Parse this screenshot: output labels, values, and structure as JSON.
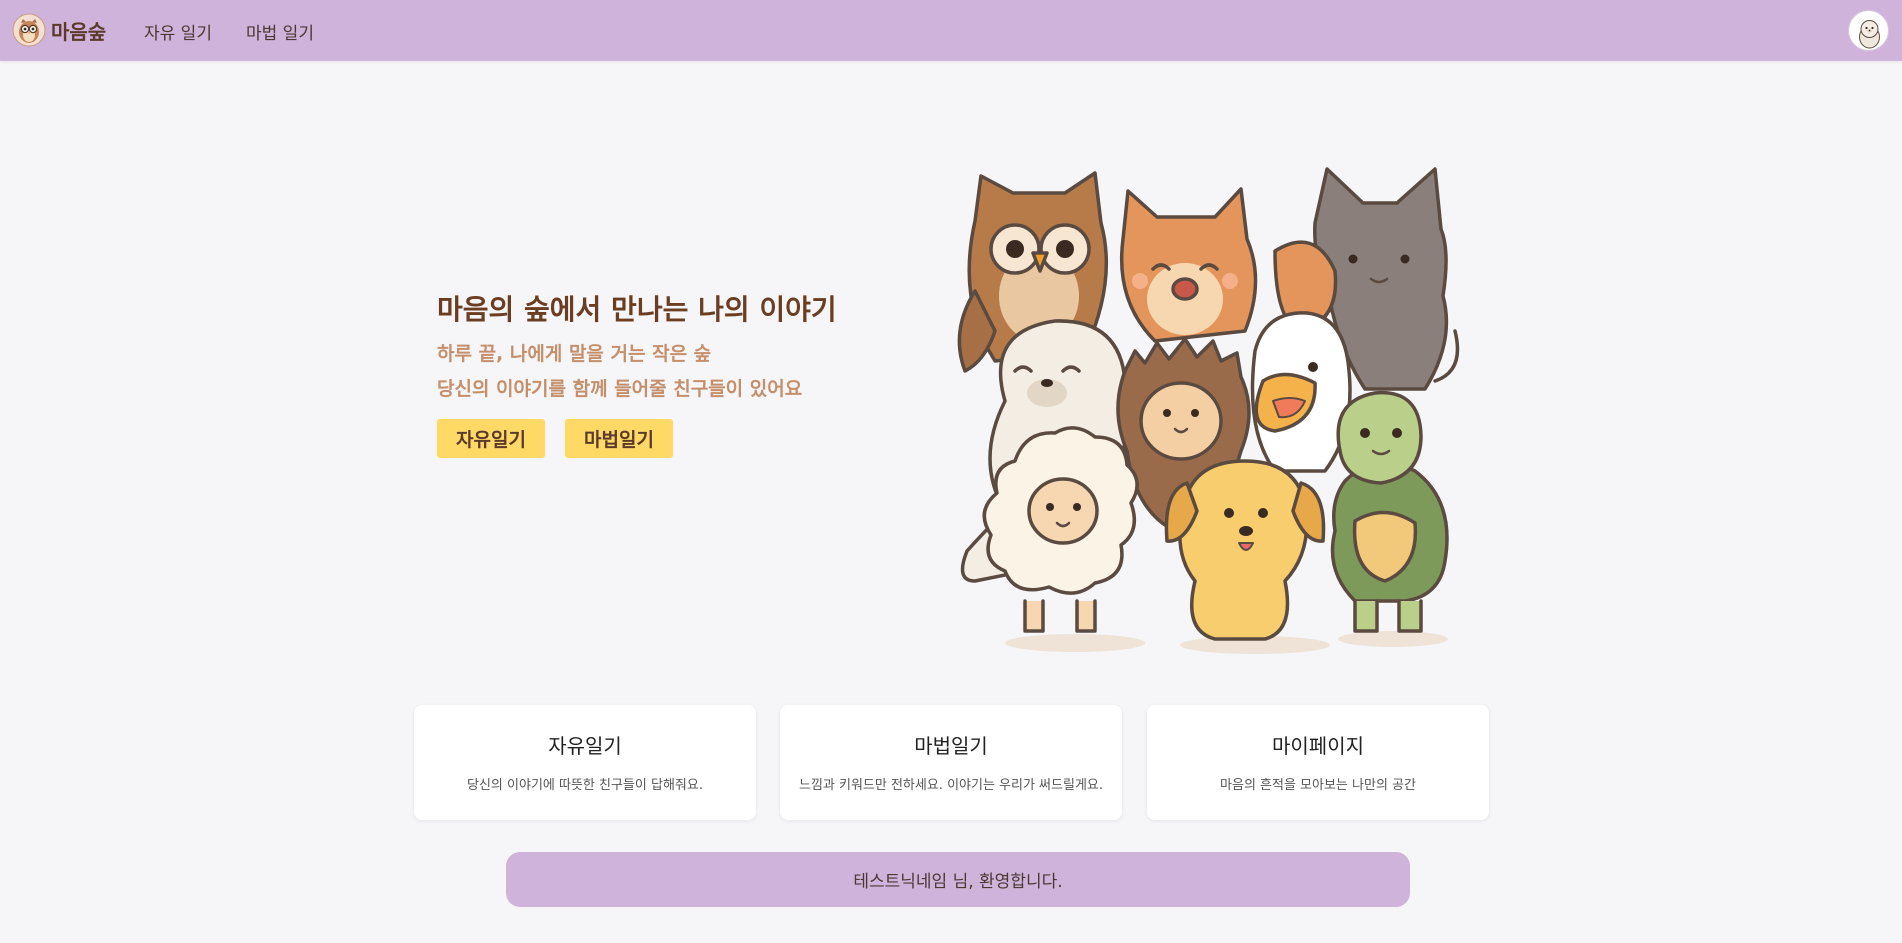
{
  "nav": {
    "brand": "마음숲",
    "links": [
      "자유 일기",
      "마법 일기"
    ]
  },
  "hero": {
    "title": "마음의 숲에서 만나는 나의 이야기",
    "subtitle1": "하루 끝, 나에게 말을 거는 작은 숲",
    "subtitle2": "당신의 이야기를 함께 들어줄 친구들이 있어요",
    "buttons": [
      "자유일기",
      "마법일기"
    ]
  },
  "cards": [
    {
      "title": "자유일기",
      "desc": "당신의 이야기에 따뜻한 친구들이 답해줘요."
    },
    {
      "title": "마법일기",
      "desc": "느낌과 키워드만 전하세요. 이야기는 우리가 써드릴게요."
    },
    {
      "title": "마이페이지",
      "desc": "마음의 흔적을 모아보는 나만의 공간"
    }
  ],
  "welcome": "테스트닉네임 님, 환영합니다.",
  "colors": {
    "navbar": "#cfb3da",
    "accent_button": "#ffd965",
    "title_brown": "#6b3e22",
    "subtitle_tan": "#c48f6a",
    "background": "#f6f6f9"
  },
  "icons": {
    "brand_logo": "owl-logo-icon",
    "avatar": "seal-avatar-icon",
    "hero_art": "animal-friends-illustration"
  }
}
